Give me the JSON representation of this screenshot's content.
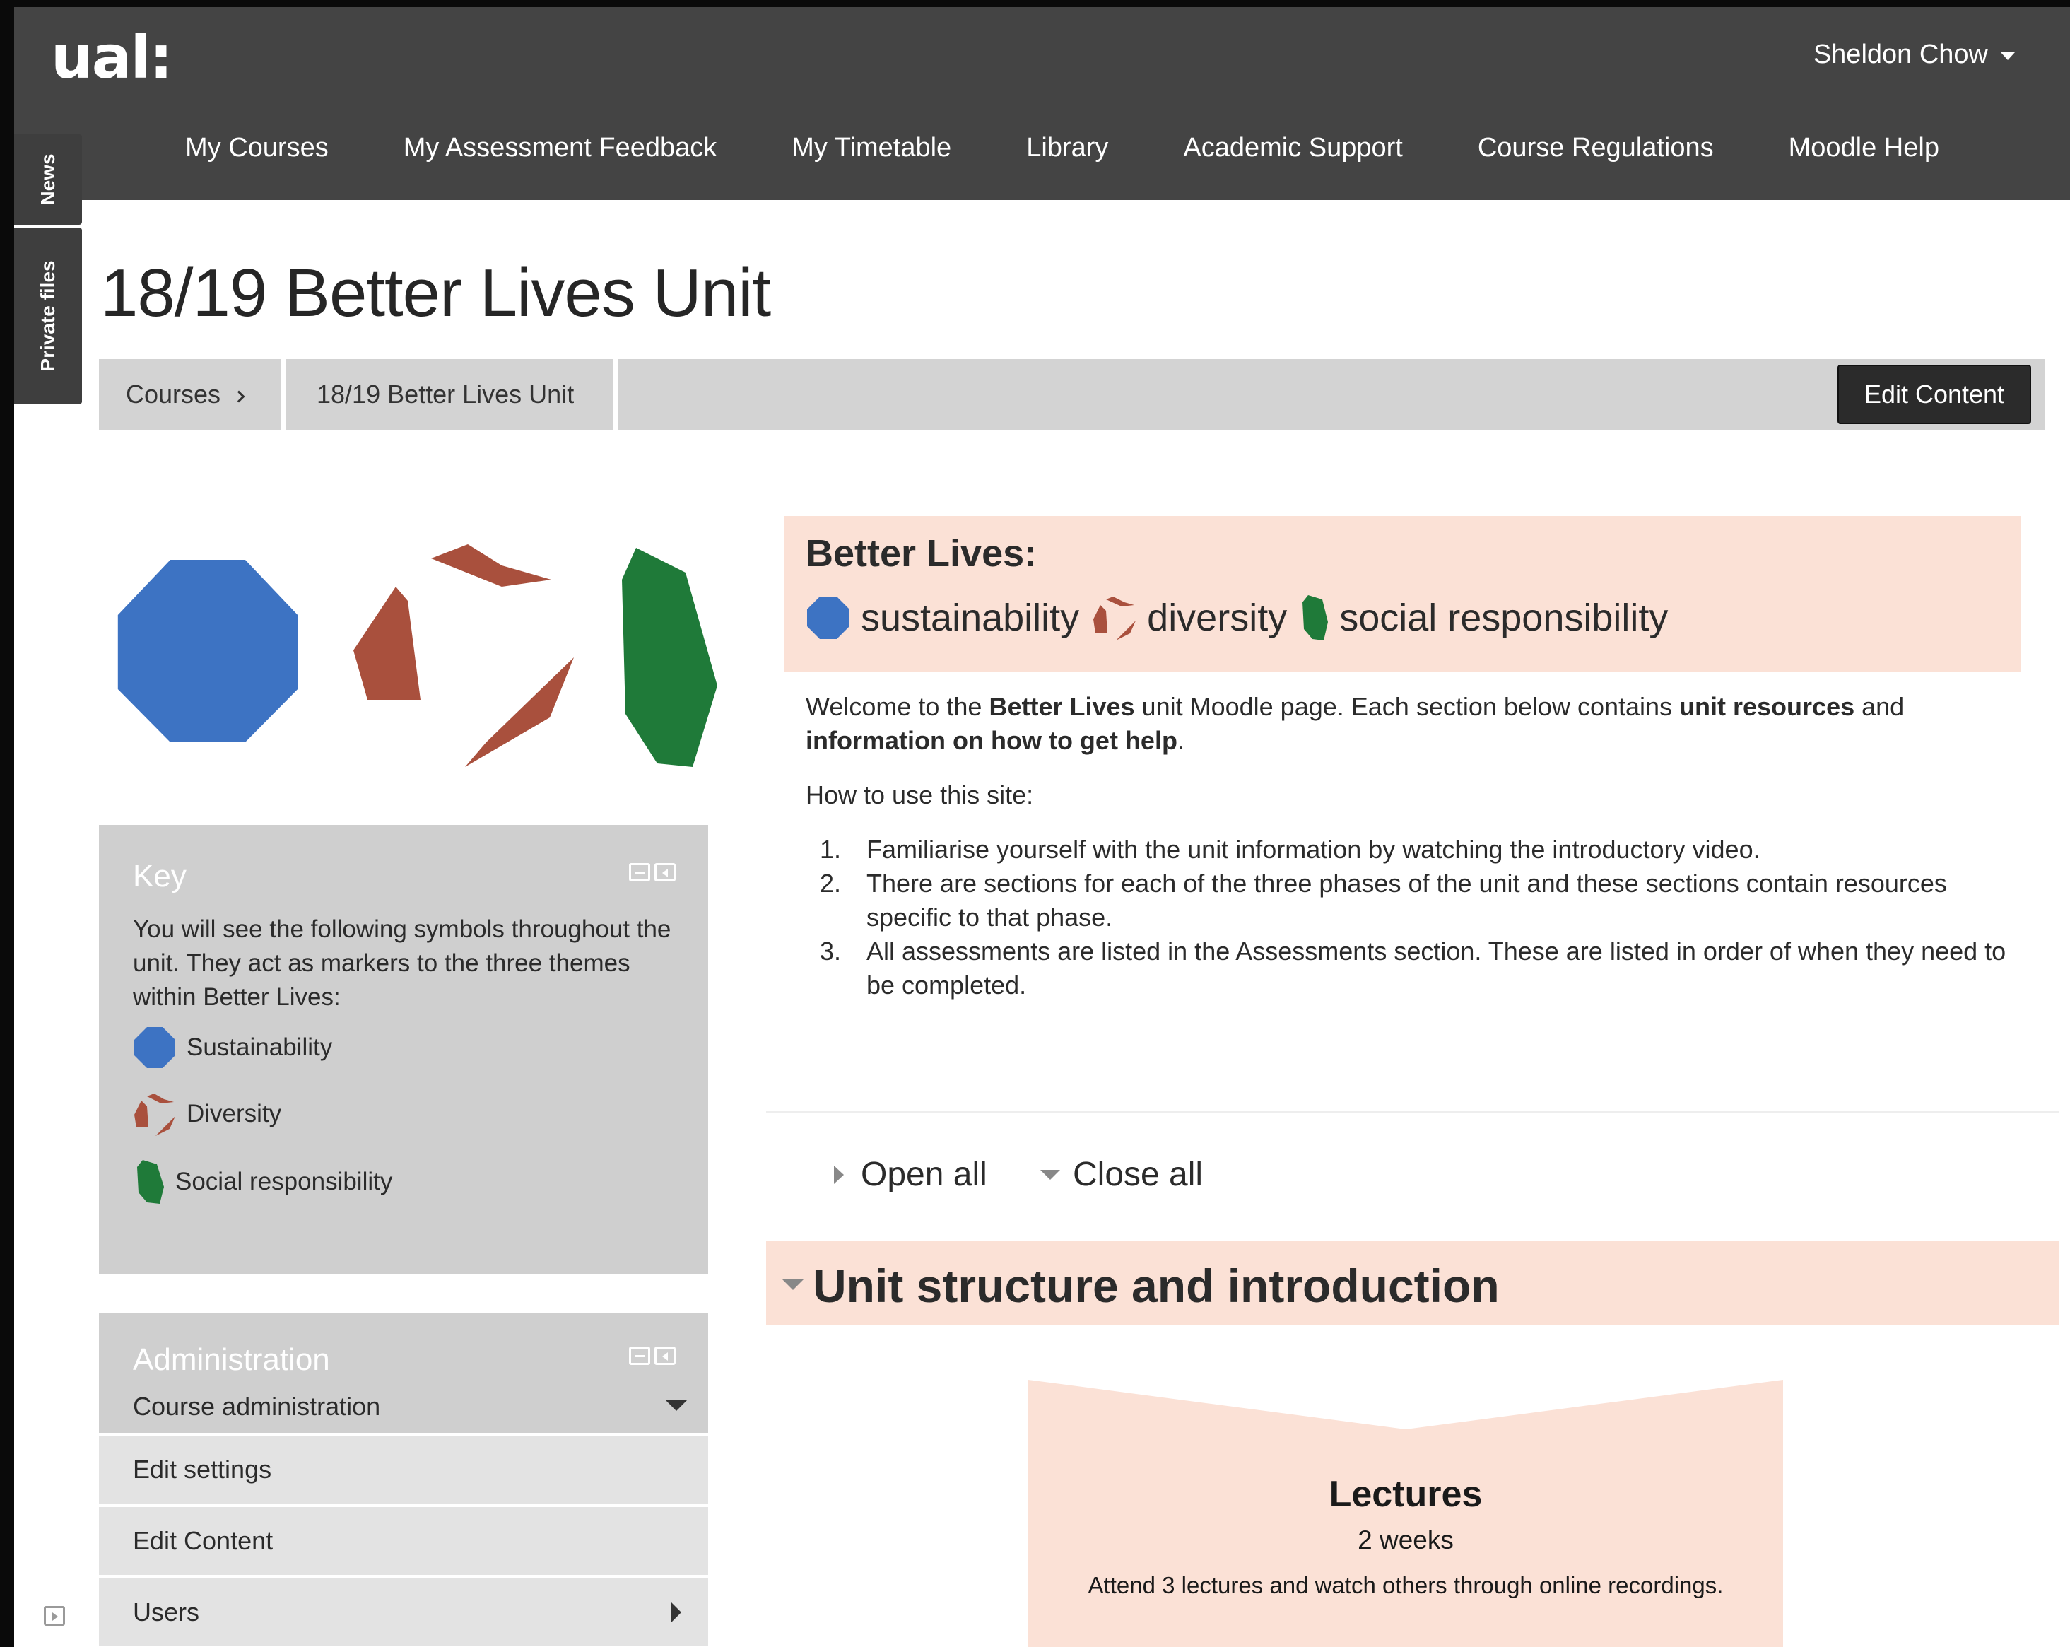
{
  "header": {
    "logo": "ual:",
    "user_name": "Sheldon Chow",
    "nav": [
      "My Courses",
      "My Assessment Feedback",
      "My Timetable",
      "Library",
      "Academic Support",
      "Course Regulations",
      "Moodle Help"
    ]
  },
  "side_tabs": {
    "news": "News",
    "private_files": "Private files"
  },
  "page": {
    "title": "18/19 Better Lives Unit",
    "breadcrumb": [
      "Courses",
      "18/19 Better Lives Unit"
    ],
    "edit_button": "Edit Content"
  },
  "key_block": {
    "title": "Key",
    "text": "You will see the following symbols throughout the unit. They act as markers to the three themes within Better Lives:",
    "items": [
      "Sustainability",
      "Diversity",
      "Social responsibility"
    ]
  },
  "admin_block": {
    "title": "Administration",
    "subtitle": "Course administration",
    "items": [
      "Edit settings",
      "Edit Content",
      "Users"
    ]
  },
  "banner": {
    "title": "Better Lives:",
    "themes": [
      "sustainability",
      "diversity",
      "social responsibility"
    ]
  },
  "intro": {
    "p1": "Welcome to the ",
    "p1_bold1": "Better Lives",
    "p1_mid": " unit Moodle page. Each section below contains ",
    "p1_bold2": "unit resources",
    "p1_and": " and ",
    "p1_bold3": "information on how to get help",
    "p1_end": ".",
    "how_to": "How to use this site:",
    "steps": [
      "Familiarise yourself with the unit information by watching the introductory video.",
      "There are sections for each of the three phases of the unit and these sections contain resources specific to that phase.",
      "All assessments are listed in the Assessments section. These are listed in order of when they need to be completed."
    ]
  },
  "controls": {
    "open_all": "Open all",
    "close_all": "Close all"
  },
  "section": {
    "title": "Unit structure and introduction",
    "card": {
      "title": "Lectures",
      "duration": "2 weeks",
      "description": "Attend 3 lectures and watch others through online recordings."
    }
  },
  "colors": {
    "header_bg": "#444444",
    "sustainability_blue": "#3d73c3",
    "diversity_red": "#a9503d",
    "social_green": "#1f7a39",
    "banner_bg": "#fbe1d6"
  }
}
